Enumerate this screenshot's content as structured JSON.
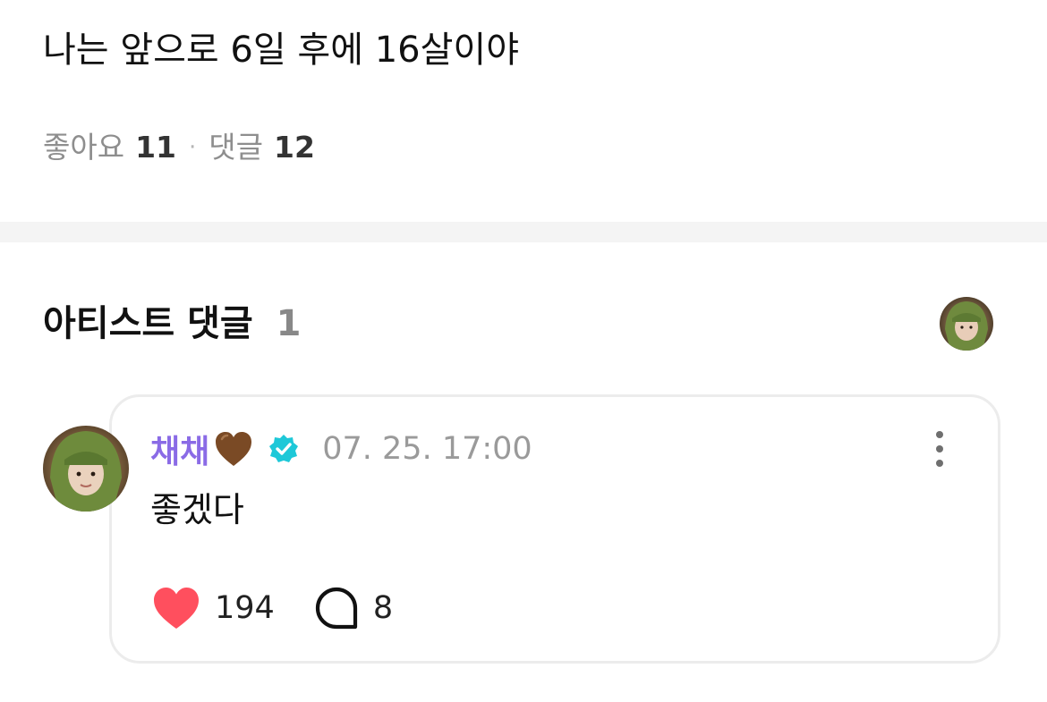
{
  "post": {
    "text": "나는 앞으로 6일 후에 16살이야"
  },
  "stats": {
    "likes_label": "좋아요",
    "likes_count": "11",
    "separator": "·",
    "comments_label": "댓글",
    "comments_count": "12"
  },
  "artist_section": {
    "title": "아티스트 댓글",
    "count": "1"
  },
  "comment": {
    "author": "채채",
    "author_emoji": "brown-heart-icon",
    "verified_color": "#1ec8d8",
    "timestamp": "07. 25. 17:00",
    "text": "좋겠다",
    "like_count": "194",
    "reply_count": "8"
  },
  "colors": {
    "author_name": "#8a6be6",
    "like_heart": "#ff4f5e",
    "divider": "#f4f4f4"
  }
}
